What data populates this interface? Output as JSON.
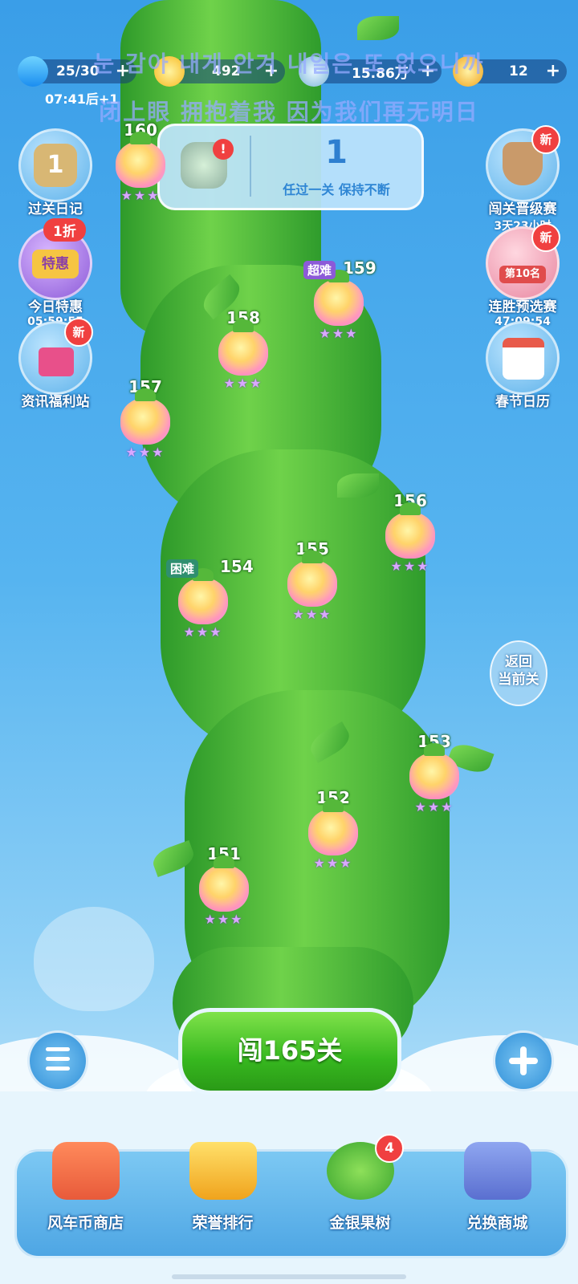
{
  "resources": {
    "energy": {
      "value": "25/30",
      "timer": "07:41后+1",
      "icon": "lightning-icon"
    },
    "stars": {
      "value": "492",
      "icon": "star-icon"
    },
    "gems": {
      "value": "15.86万",
      "icon": "gem-icon"
    },
    "coins": {
      "value": "12",
      "icon": "coin-icon"
    },
    "plus": "+"
  },
  "lyrics": {
    "line1": "눈 감아 내게 안겨 내일은 또 없으니까",
    "line2": "闭上眼 拥抱着我 因为我们再无明日"
  },
  "streak_card": {
    "count": "1",
    "caption": "任过一关 保持不断",
    "alert": "!"
  },
  "left_icons": [
    {
      "label": "过关日记",
      "badge": "1"
    },
    {
      "label": "今日特惠",
      "sub": "05:59:55",
      "tag": "1折",
      "inner": "特惠"
    },
    {
      "label": "资讯福利站",
      "badge": "新"
    }
  ],
  "right_icons": [
    {
      "label": "闯关晋级赛",
      "sub": "3天23小时",
      "badge": "新"
    },
    {
      "label": "连胜预选赛",
      "sub": "47:09:54",
      "badge": "新",
      "inner": "第10名"
    },
    {
      "label": "春节日历"
    }
  ],
  "levels": [
    {
      "num": "160",
      "stars": "★★★"
    },
    {
      "num": "159",
      "stars": "★★★",
      "tag": "超难"
    },
    {
      "num": "158",
      "stars": "★★★"
    },
    {
      "num": "157",
      "stars": "★★★"
    },
    {
      "num": "156",
      "stars": "★★★"
    },
    {
      "num": "155",
      "stars": "★★★"
    },
    {
      "num": "154",
      "stars": "★★★",
      "tag": "困难"
    },
    {
      "num": "153",
      "stars": "★★★"
    },
    {
      "num": "152",
      "stars": "★★★"
    },
    {
      "num": "151",
      "stars": "★★★"
    }
  ],
  "return_button": "返回\n当前关",
  "play_button": "闯165关",
  "bottom_nav": [
    {
      "label": "风车币商店",
      "icon": "shop-icon"
    },
    {
      "label": "荣誉排行",
      "icon": "crown-icon"
    },
    {
      "label": "金银果树",
      "icon": "fruit-tree-icon",
      "badge": "4"
    },
    {
      "label": "兑换商城",
      "icon": "lock-icon"
    }
  ],
  "colors": {
    "play_green": "#37b81f",
    "sky": "#3a9ee8",
    "vine": "#4cb83a",
    "badge_red": "#f04040"
  }
}
